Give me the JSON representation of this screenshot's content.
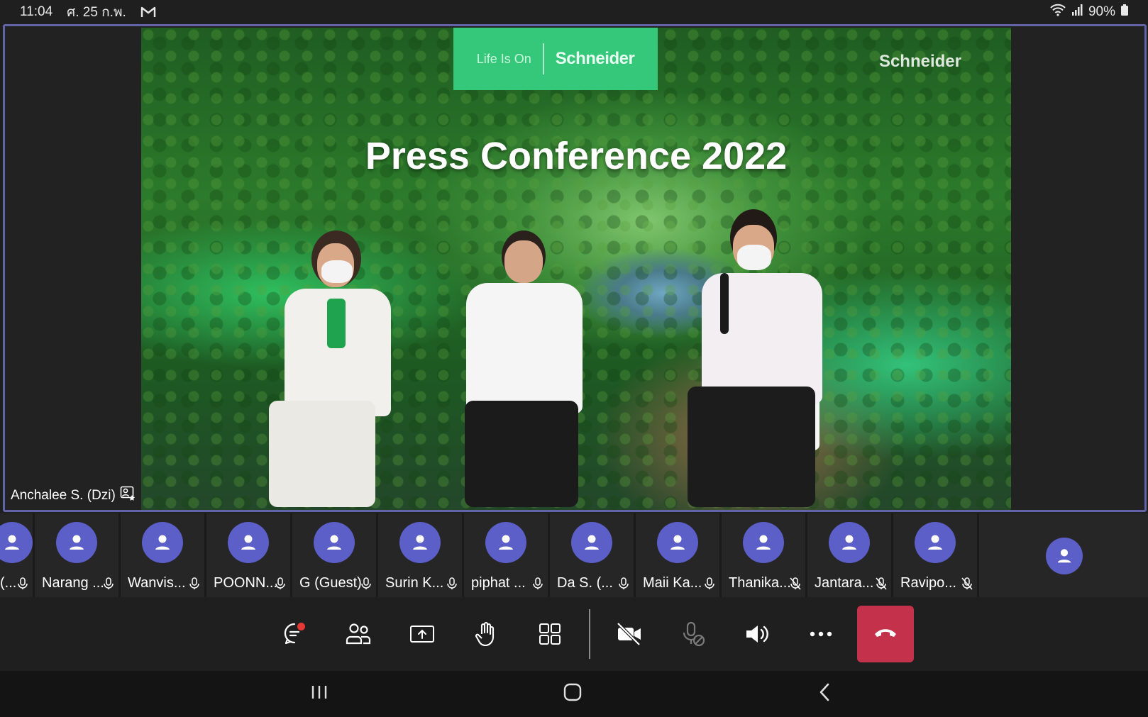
{
  "status_bar": {
    "time": "11:04",
    "date": "ศ. 25 ก.พ.",
    "battery": "90%"
  },
  "stage": {
    "speaker_name": "Anchalee S. (Dzi)",
    "video": {
      "logo_tagline": "Life Is On",
      "logo_brand": "Schneider",
      "corner_brand": "Schneider",
      "headline": "Press Conference 2022"
    }
  },
  "participants": [
    {
      "name": "(..."
    },
    {
      "name": "Narang ..."
    },
    {
      "name": "Wanvis..."
    },
    {
      "name": "POONN..."
    },
    {
      "name": "G (Guest)"
    },
    {
      "name": "Surin K..."
    },
    {
      "name": "piphat ..."
    },
    {
      "name": "Da S. (..."
    },
    {
      "name": "Maii Ka..."
    },
    {
      "name": "Thanika..."
    },
    {
      "name": "Jantara..."
    },
    {
      "name": "Ravipo..."
    }
  ],
  "colors": {
    "accent": "#6264a7",
    "avatar": "#5b5fc7",
    "hangup": "#c4314b",
    "badge": "#e53935"
  }
}
